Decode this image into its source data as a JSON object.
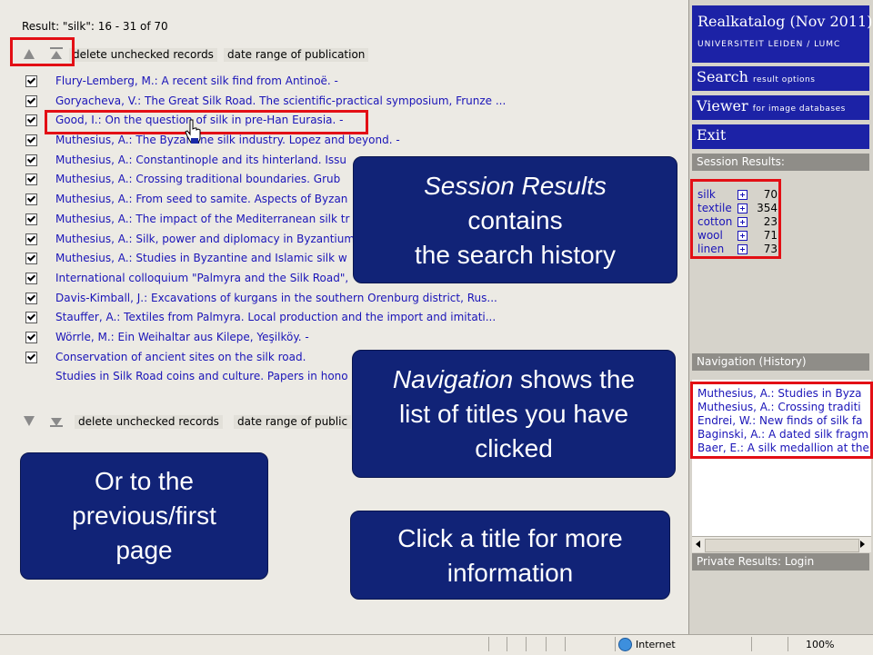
{
  "results": {
    "header": "Result: \"silk\": 16 - 31 of 70",
    "toolbar": {
      "delete_label": "delete unchecked records",
      "date_label": "date range of publication",
      "bottom_date_label": "date range of public"
    },
    "records": [
      {
        "title": "Flury-Lemberg, M.: A recent silk find from Antinoë. -",
        "checked": true
      },
      {
        "title": "Goryacheva, V.: The Great Silk Road. The scientific-practical symposium, Frunze ...",
        "checked": true
      },
      {
        "title": "Good, I.: On the question of silk in pre-Han Eurasia. -",
        "checked": true
      },
      {
        "title": "Muthesius, A.: The Byzantine silk industry. Lopez and beyond. -",
        "checked": true
      },
      {
        "title": "Muthesius, A.: Constantinople and its hinterland. Issu",
        "checked": true
      },
      {
        "title": "Muthesius, A.: Crossing traditional boundaries. Grub",
        "checked": true
      },
      {
        "title": "Muthesius, A.: From seed to samite. Aspects of Byzan",
        "checked": true
      },
      {
        "title": "Muthesius, A.: The impact of the Mediterranean silk tr",
        "checked": true
      },
      {
        "title": "Muthesius, A.: Silk, power and diplomacy in Byzantium",
        "checked": true
      },
      {
        "title": "Muthesius, A.: Studies in Byzantine and Islamic silk w",
        "checked": true
      },
      {
        "title": "International colloquium \"Palmyra and the Silk Road\",",
        "checked": true
      },
      {
        "title": "Davis-Kimball, J.: Excavations of kurgans in the southern Orenburg district, Rus...",
        "checked": true
      },
      {
        "title": "Stauffer, A.: Textiles from Palmyra. Local production and the import and imitati...",
        "checked": true
      },
      {
        "title": "Wörrle, M.: Ein Weihaltar aus Kilepe, Yeşilköy. -",
        "checked": true
      },
      {
        "title": "Conservation of ancient sites on the silk road.",
        "checked": true
      },
      {
        "title": "Studies in Silk Road coins and culture. Papers in hono",
        "checked": false
      }
    ]
  },
  "sidebar": {
    "title": "Realkatalog (Nov 2011)",
    "subtitle": "UNIVERSITEIT LEIDEN / LUMC",
    "nav": [
      {
        "big": "Search",
        "small": "result options"
      },
      {
        "big": "Viewer",
        "small": "for image databases"
      },
      {
        "big": "Exit",
        "small": ""
      }
    ],
    "session_header": "Session Results:",
    "session": [
      {
        "term": "silk",
        "count": "70"
      },
      {
        "term": "textile",
        "count": "354"
      },
      {
        "term": "cotton",
        "count": "23"
      },
      {
        "term": "wool",
        "count": "71"
      },
      {
        "term": "linen",
        "count": "73"
      }
    ],
    "history_header": "Navigation (History)",
    "history": [
      "Muthesius, A.: Studies in Byza",
      "Muthesius, A.: Crossing traditi",
      "Endrei, W.: New finds of silk fa",
      "Baginski, A.: A dated silk fragm",
      "Baer, E.: A silk medallion at the"
    ],
    "private_label": "Private Results: Login"
  },
  "callouts": {
    "session": {
      "em": "Session Results",
      "line2": "contains",
      "line3": "the search history"
    },
    "navigation": {
      "em": "Navigation",
      "rest": " shows the",
      "line2": "list of titles you have",
      "line3": "clicked"
    },
    "previous": {
      "line1": "Or to the",
      "line2": "previous/first",
      "line3": "page"
    },
    "click": {
      "line1": "Click a title for more",
      "line2": "information"
    }
  },
  "statusbar": {
    "zone": "Internet",
    "zoom": "100%"
  },
  "colors": {
    "link": "#1a14b8",
    "sidebar_blue": "#1c22a6",
    "callout_bg": "#112377",
    "highlight": "#e30f15"
  }
}
